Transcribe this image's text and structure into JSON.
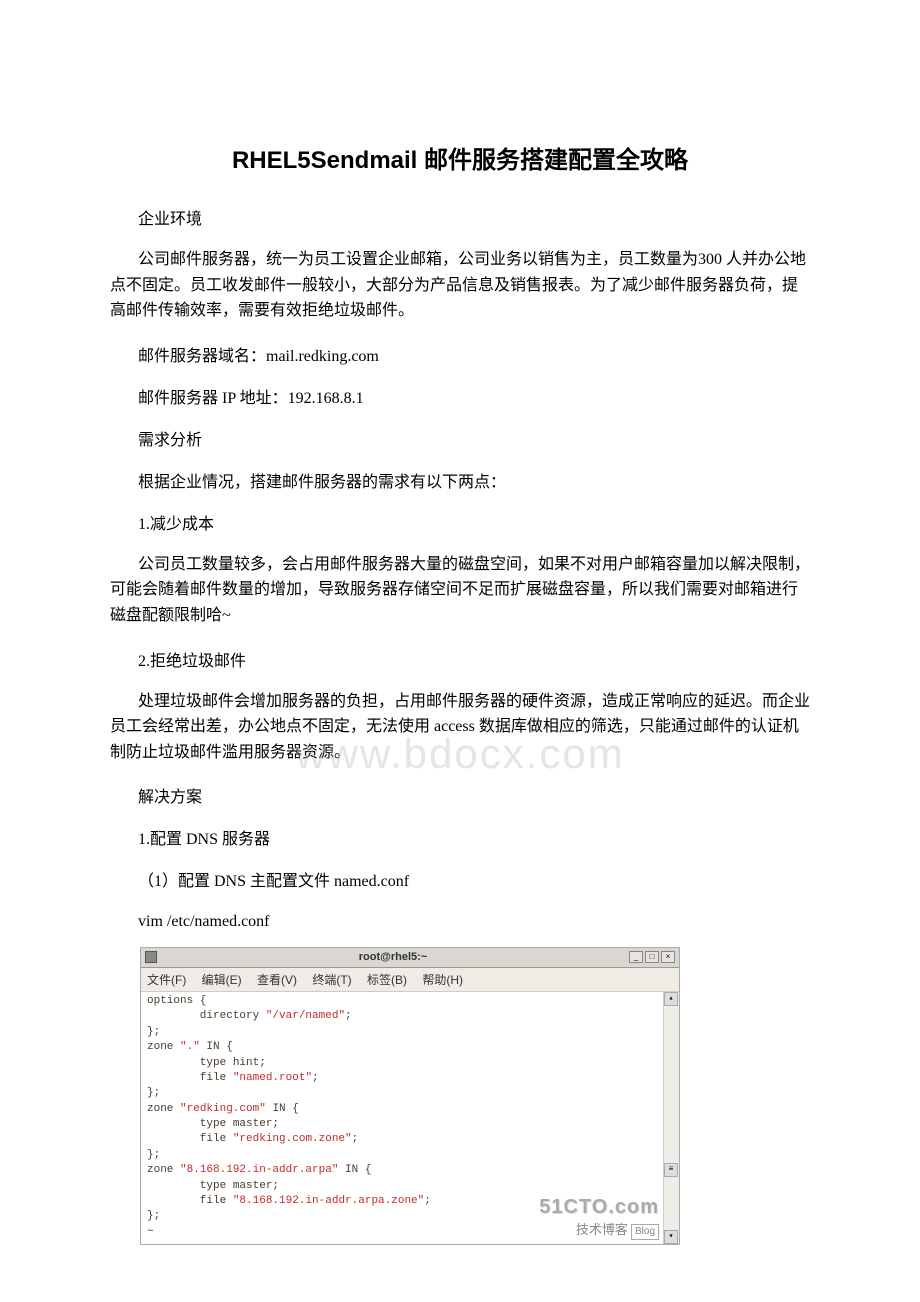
{
  "title": "RHEL5Sendmail 邮件服务搭建配置全攻略",
  "section_env": "企业环境",
  "p_company": "公司邮件服务器，统一为员工设置企业邮箱，公司业务以销售为主，员工数量为300 人并办公地点不固定。员工收发邮件一般较小，大部分为产品信息及销售报表。为了减少邮件服务器负荷，提高邮件传输效率，需要有效拒绝垃圾邮件。",
  "p_domain": "邮件服务器域名：mail.redking.com",
  "p_ip": "邮件服务器 IP 地址：192.168.8.1",
  "section_req": "需求分析",
  "p_req_intro": "根据企业情况，搭建邮件服务器的需求有以下两点：",
  "p_cost_h": "1.减少成本",
  "p_cost": "公司员工数量较多，会占用邮件服务器大量的磁盘空间，如果不对用户邮箱容量加以解决限制，可能会随着邮件数量的增加，导致服务器存储空间不足而扩展磁盘容量，所以我们需要对邮箱进行磁盘配额限制哈~",
  "p_spam_h": "2.拒绝垃圾邮件",
  "p_spam": "处理垃圾邮件会增加服务器的负担，占用邮件服务器的硬件资源，造成正常响应的延迟。而企业员工会经常出差，办公地点不固定，无法使用 access 数据库做相应的筛选，只能通过邮件的认证机制防止垃圾邮件滥用服务器资源。",
  "section_sol": "解决方案",
  "p_dns_h": "1.配置 DNS 服务器",
  "p_dns_conf": "（1）配置 DNS 主配置文件 named.conf",
  "p_vim": "vim /etc/named.conf",
  "watermark": "www.bdocx.com",
  "terminal": {
    "title": "root@rhel5:~",
    "menu": {
      "file": "文件(F)",
      "edit": "编辑(E)",
      "view": "查看(V)",
      "terminal": "终端(T)",
      "tabs": "标签(B)",
      "help": "帮助(H)"
    },
    "code": {
      "l1": "options {",
      "l2a": "        directory ",
      "l2b": "\"/var/named\"",
      "l2c": ";",
      "l3": "};",
      "l4a": "zone ",
      "l4b": "\".\"",
      "l4c": " IN {",
      "l5": "        type hint;",
      "l6a": "        file ",
      "l6b": "\"named.root\"",
      "l6c": ";",
      "l7": "};",
      "l8a": "zone ",
      "l8b": "\"redking.com\"",
      "l8c": " IN {",
      "l9": "        type master;",
      "l10a": "        file ",
      "l10b": "\"redking.com.zone\"",
      "l10c": ";",
      "l11": "};",
      "l12a": "zone ",
      "l12b": "\"8.168.192.in-addr.arpa\"",
      "l12c": " IN {",
      "l13": "        type master;",
      "l14a": "        file ",
      "l14b": "\"8.168.192.in-addr.arpa.zone\"",
      "l14c": ";",
      "l15": "};",
      "l16": "~"
    },
    "logo_big": "51CTO.com",
    "logo_small": "技术博客",
    "logo_blog": "Blog"
  }
}
